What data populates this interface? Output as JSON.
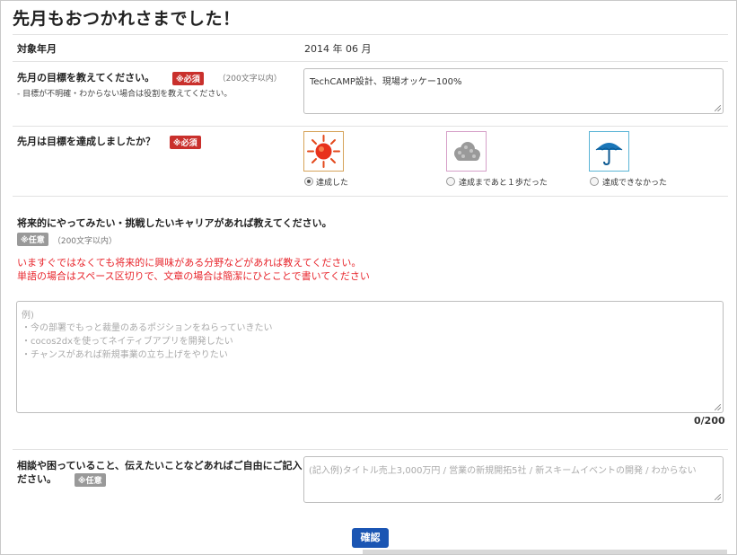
{
  "page": {
    "title": "先月もおつかれさまでした！"
  },
  "badges": {
    "required": "※必須",
    "optional": "※任意"
  },
  "period": {
    "label": "対象年月",
    "value": "2014 年 06 月"
  },
  "goal": {
    "label": "先月の目標を教えてください。",
    "limit": "（200文字以内）",
    "note": "- 目標が不明確・わからない場合は役割を教えてください。",
    "value": "TechCAMP設計、現場オッケー100%"
  },
  "achieve": {
    "label": "先月は目標を達成しましたか？",
    "options": [
      {
        "label": "達成した",
        "icon": "sun-icon",
        "selected": true
      },
      {
        "label": "達成まであと１歩だった",
        "icon": "cloud-icon",
        "selected": false
      },
      {
        "label": "達成できなかった",
        "icon": "umbrella-icon",
        "selected": false
      }
    ]
  },
  "career": {
    "label": "将来的にやってみたい・挑戦したいキャリアがあれば教えてください。",
    "limit": "（200文字以内）",
    "desc_line1": "いますぐではなくても将来的に興味がある分野などがあれば教えてください。",
    "desc_line2": "単語の場合はスペース区切りで、文章の場合は簡潔にひとことで書いてください",
    "placeholder_lines": [
      "例)",
      "・今の部署でもっと裁量のあるポジションをねらっていきたい",
      "・cocos2dxを使ってネイティブアプリを開発したい",
      "・チャンスがあれば新規事業の立ち上げをやりたい"
    ],
    "counter": "0/200"
  },
  "consult": {
    "label_line1": "相談や困っていること、伝えたいことなどあればご自由にご記入く",
    "label_line2": "ださい。",
    "placeholder": "(記入例)タイトル売上3,000万円 / 営業の新規開拓5社 / 新スキームイベントの開発 / わからない"
  },
  "confirm": {
    "label": "確認"
  },
  "colors": {
    "required_badge": "#c9302c",
    "optional_badge": "#999999",
    "notice_red": "#e8262d",
    "button_blue": "#1a55b3"
  }
}
